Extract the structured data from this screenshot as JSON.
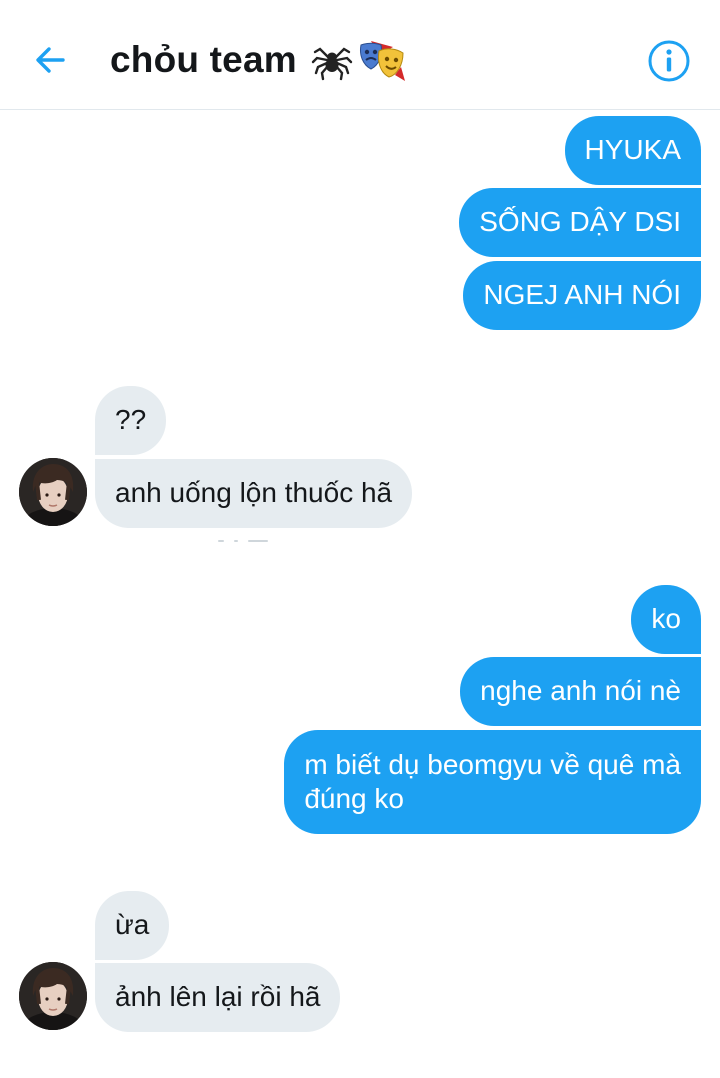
{
  "header": {
    "title": "chỏu team",
    "title_emoji": [
      "spider-icon",
      "performing-arts-icon"
    ],
    "back_icon": "arrow-left-icon",
    "info_icon": "info-icon"
  },
  "colors": {
    "accent": "#1da1f2",
    "sent_bubble": "#1da1f2",
    "received_bubble": "#e6ecf0",
    "text": "#14171a"
  },
  "messages": [
    {
      "from": "me",
      "text": "HYUKA"
    },
    {
      "from": "me",
      "text": "SỐNG DẬY DSI"
    },
    {
      "from": "me",
      "text": "NGEJ ANH NÓI"
    },
    {
      "from": "them",
      "text": "??"
    },
    {
      "from": "them",
      "text": "anh uống lộn thuốc hã"
    },
    {
      "from": "me",
      "text": "ko"
    },
    {
      "from": "me",
      "text": "nghe anh nói nè"
    },
    {
      "from": "me",
      "text": "m biết dụ beomgyu về quê mà đúng ko",
      "lines": [
        "m biết dụ beomgyu về quê mà",
        "đúng ko"
      ]
    },
    {
      "from": "them",
      "text": "ừa"
    },
    {
      "from": "them",
      "text": "ảnh lên lại rồi hã"
    }
  ]
}
